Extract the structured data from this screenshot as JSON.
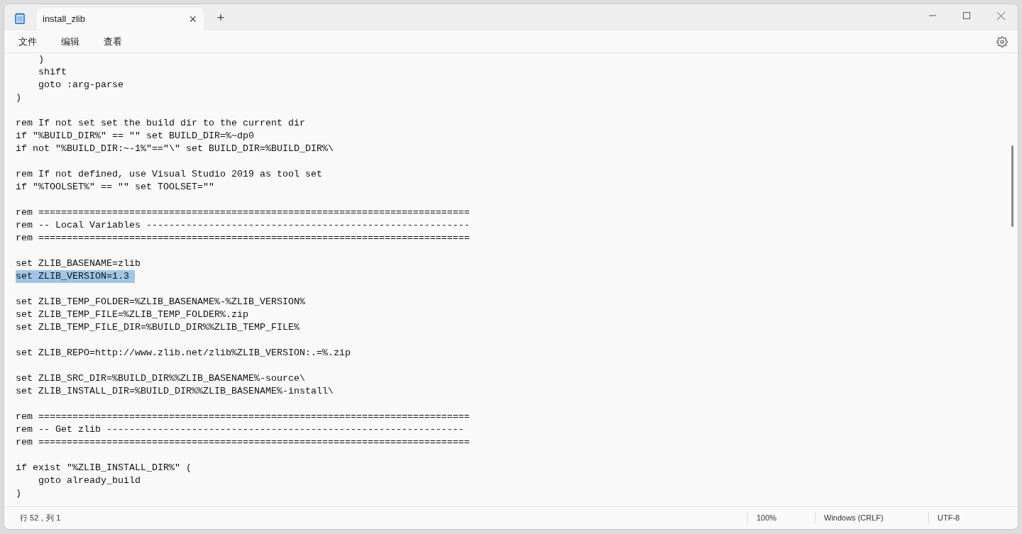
{
  "tabs": [
    {
      "title": "install_zlib"
    }
  ],
  "tab_close": "×",
  "new_tab": "+",
  "menu": [
    "文件",
    "编辑",
    "查看"
  ],
  "lines": [
    {
      "kind": "code",
      "text": "    )",
      "selected": false
    },
    {
      "kind": "code",
      "text": "    shift",
      "selected": false
    },
    {
      "kind": "code",
      "text": "    goto :arg-parse",
      "selected": false
    },
    {
      "kind": "code",
      "text": ")",
      "selected": false
    },
    {
      "kind": "blank",
      "selected": false
    },
    {
      "kind": "code",
      "text": "rem If not set set the build dir to the current dir",
      "selected": false
    },
    {
      "kind": "code",
      "text": "if \"%BUILD_DIR%\" == \"\" set BUILD_DIR=%~dp0",
      "selected": false
    },
    {
      "kind": "code",
      "text": "if not \"%BUILD_DIR:~-1%\"==\"\\\" set BUILD_DIR=%BUILD_DIR%\\",
      "selected": false
    },
    {
      "kind": "blank",
      "selected": false
    },
    {
      "kind": "code",
      "text": "rem If not defined, use Visual Studio 2019 as tool set",
      "selected": false
    },
    {
      "kind": "code",
      "text": "if \"%TOOLSET%\" == \"\" set TOOLSET=\"\"",
      "selected": false
    },
    {
      "kind": "blank",
      "selected": false
    },
    {
      "kind": "code",
      "text": "rem ============================================================================",
      "selected": false
    },
    {
      "kind": "code",
      "text": "rem -- Local Variables ---------------------------------------------------------",
      "selected": false
    },
    {
      "kind": "code",
      "text": "rem ============================================================================",
      "selected": false
    },
    {
      "kind": "blank",
      "selected": false
    },
    {
      "kind": "code",
      "text": "set ZLIB_BASENAME=zlib",
      "selected": false
    },
    {
      "kind": "code",
      "text": "set ZLIB_VERSION=1.3",
      "selected": true
    },
    {
      "kind": "blank",
      "selected": false
    },
    {
      "kind": "code",
      "text": "set ZLIB_TEMP_FOLDER=%ZLIB_BASENAME%-%ZLIB_VERSION%",
      "selected": false
    },
    {
      "kind": "code",
      "text": "set ZLIB_TEMP_FILE=%ZLIB_TEMP_FOLDER%.zip",
      "selected": false
    },
    {
      "kind": "code",
      "text": "set ZLIB_TEMP_FILE_DIR=%BUILD_DIR%%ZLIB_TEMP_FILE%",
      "selected": false
    },
    {
      "kind": "blank",
      "selected": false
    },
    {
      "kind": "code",
      "text": "set ZLIB_REPO=http://www.zlib.net/zlib%ZLIB_VERSION:.=%.zip",
      "selected": false
    },
    {
      "kind": "blank",
      "selected": false
    },
    {
      "kind": "code",
      "text": "set ZLIB_SRC_DIR=%BUILD_DIR%%ZLIB_BASENAME%-source\\",
      "selected": false
    },
    {
      "kind": "code",
      "text": "set ZLIB_INSTALL_DIR=%BUILD_DIR%%ZLIB_BASENAME%-install\\",
      "selected": false
    },
    {
      "kind": "blank",
      "selected": false
    },
    {
      "kind": "code",
      "text": "rem ============================================================================",
      "selected": false
    },
    {
      "kind": "code",
      "text": "rem -- Get zlib ---------------------------------------------------------------",
      "selected": false
    },
    {
      "kind": "code",
      "text": "rem ============================================================================",
      "selected": false
    },
    {
      "kind": "blank",
      "selected": false
    },
    {
      "kind": "code",
      "text": "if exist \"%ZLIB_INSTALL_DIR%\" (",
      "selected": false
    },
    {
      "kind": "code",
      "text": "    goto already_build",
      "selected": false
    },
    {
      "kind": "code",
      "text": ")",
      "selected": false
    }
  ],
  "status_bar": {
    "position": "行 52，列 1",
    "zoom": "100%",
    "line_ending": "Windows (CRLF)",
    "encoding": "UTF-8"
  }
}
